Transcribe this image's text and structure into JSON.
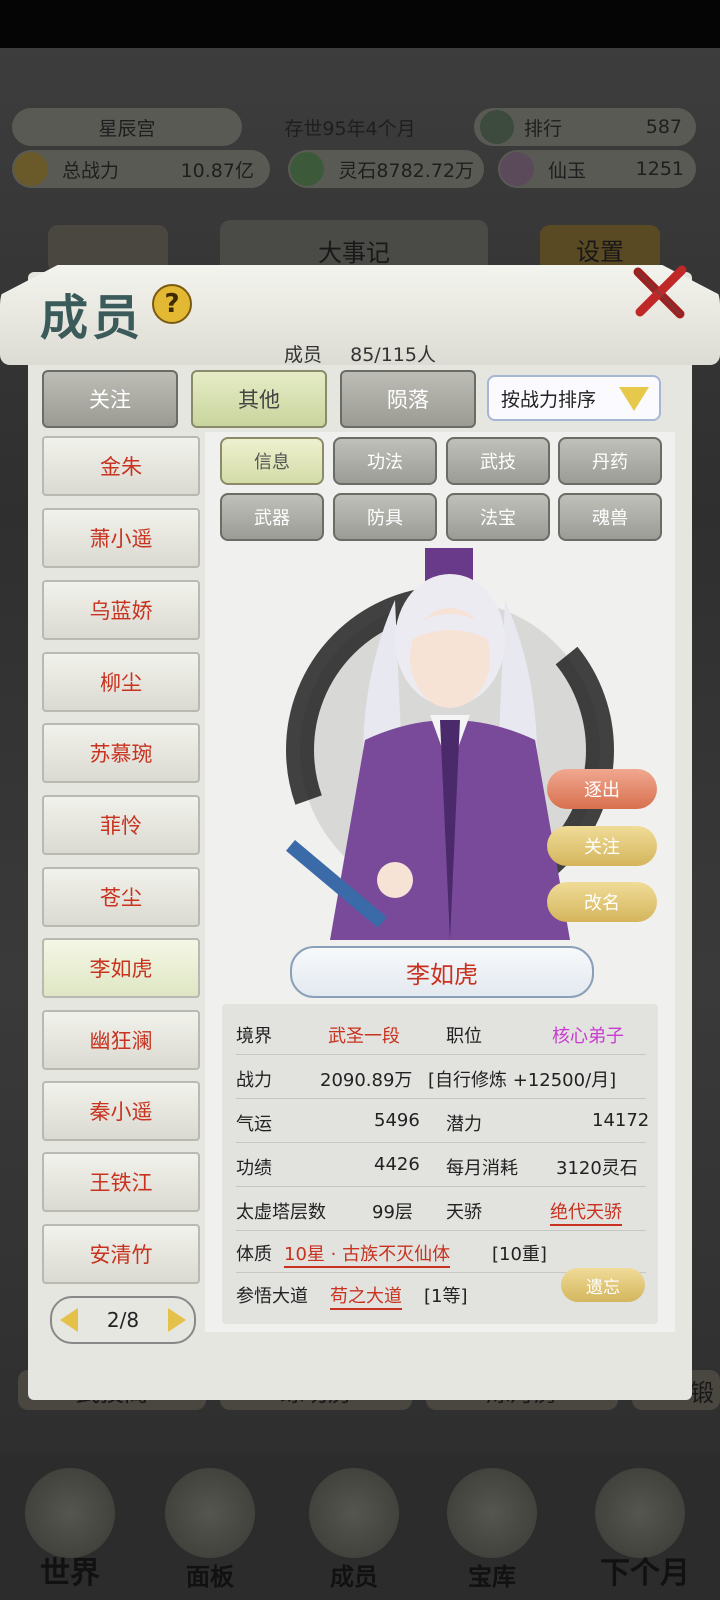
{
  "hud": {
    "sect_name": "星辰宫",
    "age": "存世95年4个月",
    "rank_label": "排行",
    "rank_value": "587",
    "power_label": "总战力",
    "power_value": "10.87亿",
    "spirit_stone": "灵石8782.72万",
    "jade_label": "仙玉",
    "jade_value": "1251"
  },
  "background": {
    "events_button": "大事记",
    "settings_button": "设置",
    "row_buttons": [
      "武技阁",
      "练功房",
      "炼丹房",
      "锻"
    ]
  },
  "bottom_nav": [
    {
      "label": "世界"
    },
    {
      "label": "面板"
    },
    {
      "label": "成员"
    },
    {
      "label": "宝库"
    },
    {
      "label": "下个月"
    }
  ],
  "panel": {
    "title": "成员",
    "help": "?",
    "count_label": "成员",
    "count_value": "85/115人",
    "tabs": [
      "关注",
      "其他",
      "陨落"
    ],
    "active_tab": 1,
    "sort_label": "按战力排序",
    "members": [
      "金朱",
      "萧小遥",
      "乌蓝娇",
      "柳尘",
      "苏慕琬",
      "菲怜",
      "苍尘",
      "李如虎",
      "幽狂澜",
      "秦小遥",
      "王铁江",
      "安清竹"
    ],
    "active_member": 7,
    "subtabs_row1": [
      "信息",
      "功法",
      "武技",
      "丹药"
    ],
    "subtabs_row2": [
      "武器",
      "防具",
      "法宝",
      "魂兽"
    ],
    "active_subtab": 0,
    "actions": [
      "逐出",
      "关注",
      "改名"
    ],
    "action_colors": [
      "#e1826b",
      "#e2c86e",
      "#e2c86e"
    ],
    "character_name": "李如虎",
    "info": {
      "realm_label": "境界",
      "realm_value": "武圣一段",
      "position_label": "职位",
      "position_value": "核心弟子",
      "combat_label": "战力",
      "combat_value": "2090.89万",
      "training": "[自行修炼 +12500/月]",
      "luck_label": "气运",
      "luck_value": "5496",
      "potential_label": "潜力",
      "potential_value": "14172",
      "merit_label": "功绩",
      "merit_value": "4426",
      "cost_label": "每月消耗",
      "cost_value": "3120灵石",
      "tower_label": "太虚塔层数",
      "tower_value": "99层",
      "talent_label": "天骄",
      "talent_value": "绝代天骄",
      "physique_label": "体质",
      "physique_value": "10星 · 古族不灭仙体",
      "physique_level": "[10重]",
      "dao_label": "参悟大道",
      "dao_value": "苟之大道",
      "dao_level": "[1等]",
      "leave_button": "遗忘"
    },
    "pager": "2/8"
  }
}
